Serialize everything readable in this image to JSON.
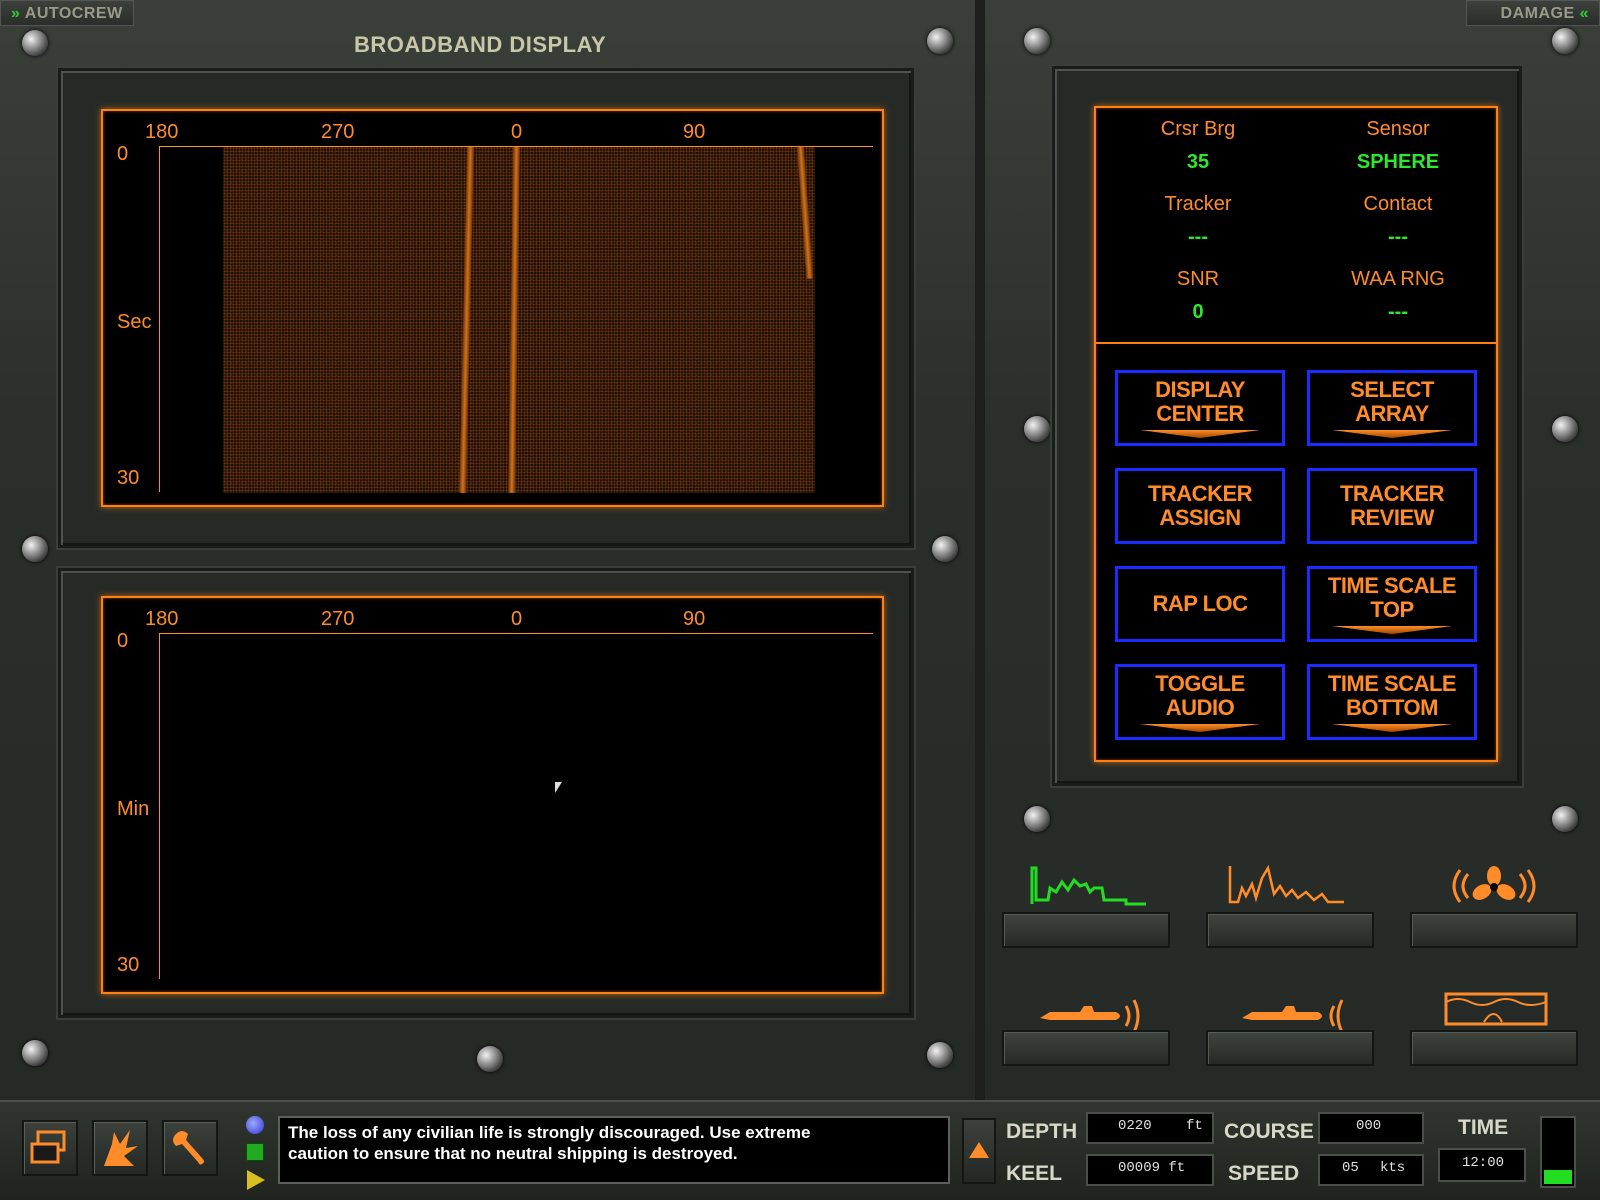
{
  "header": {
    "autocrew_label": "AUTOCREW",
    "damage_label": "DAMAGE",
    "title": "BROADBAND DISPLAY"
  },
  "top_display": {
    "bearing_ticks": [
      "180",
      "270",
      "0",
      "90"
    ],
    "time_top": "0",
    "time_unit": "Sec",
    "time_bottom": "30"
  },
  "bottom_display": {
    "bearing_ticks": [
      "180",
      "270",
      "0",
      "90"
    ],
    "time_top": "0",
    "time_unit": "Min",
    "time_bottom": "30"
  },
  "info_panel": {
    "cursor_bearing_label": "Crsr Brg",
    "cursor_bearing_value": "35",
    "sensor_label": "Sensor",
    "sensor_value": "SPHERE",
    "tracker_label": "Tracker",
    "tracker_value": "---",
    "contact_label": "Contact",
    "contact_value": "---",
    "snr_label": "SNR",
    "snr_value": "0",
    "waa_rng_label": "WAA RNG",
    "waa_rng_value": "---"
  },
  "commands": {
    "display_center": [
      "DISPLAY",
      "CENTER"
    ],
    "select_array": [
      "SELECT",
      "ARRAY"
    ],
    "tracker_assign": [
      "TRACKER",
      "ASSIGN"
    ],
    "tracker_review": [
      "TRACKER",
      "REVIEW"
    ],
    "rap_loc": "RAP LOC",
    "time_scale_top": [
      "TIME SCALE",
      "TOP"
    ],
    "toggle_audio": [
      "TOGGLE",
      "AUDIO"
    ],
    "time_scale_bottom": [
      "TIME SCALE",
      "BOTTOM"
    ]
  },
  "stations": {
    "broadband_icon": "broadband-waveform-icon",
    "narrowband_icon": "narrowband-waveform-icon",
    "demon_icon": "propeller-sound-icon",
    "active_sonar_icon": "submarine-ping-icon",
    "passive_sonar_icon": "submarine-listen-icon",
    "nav_icon": "ocean-profile-icon",
    "active_color": "#22dd22",
    "inactive_color": "#ff8c28"
  },
  "status_bar": {
    "message_line1": "The loss of any civilian life is strongly discouraged. Use extreme",
    "message_line2": "caution to ensure that no neutral shipping is destroyed.",
    "depth_label": "DEPTH",
    "depth_value": "0220",
    "depth_unit": "ft",
    "keel_label": "KEEL",
    "keel_value": "00009 ft",
    "course_label": "COURSE",
    "course_value": "000",
    "speed_label": "SPEED",
    "speed_value": "05",
    "speed_unit": "kts",
    "time_label": "TIME",
    "time_value": "12:00"
  }
}
